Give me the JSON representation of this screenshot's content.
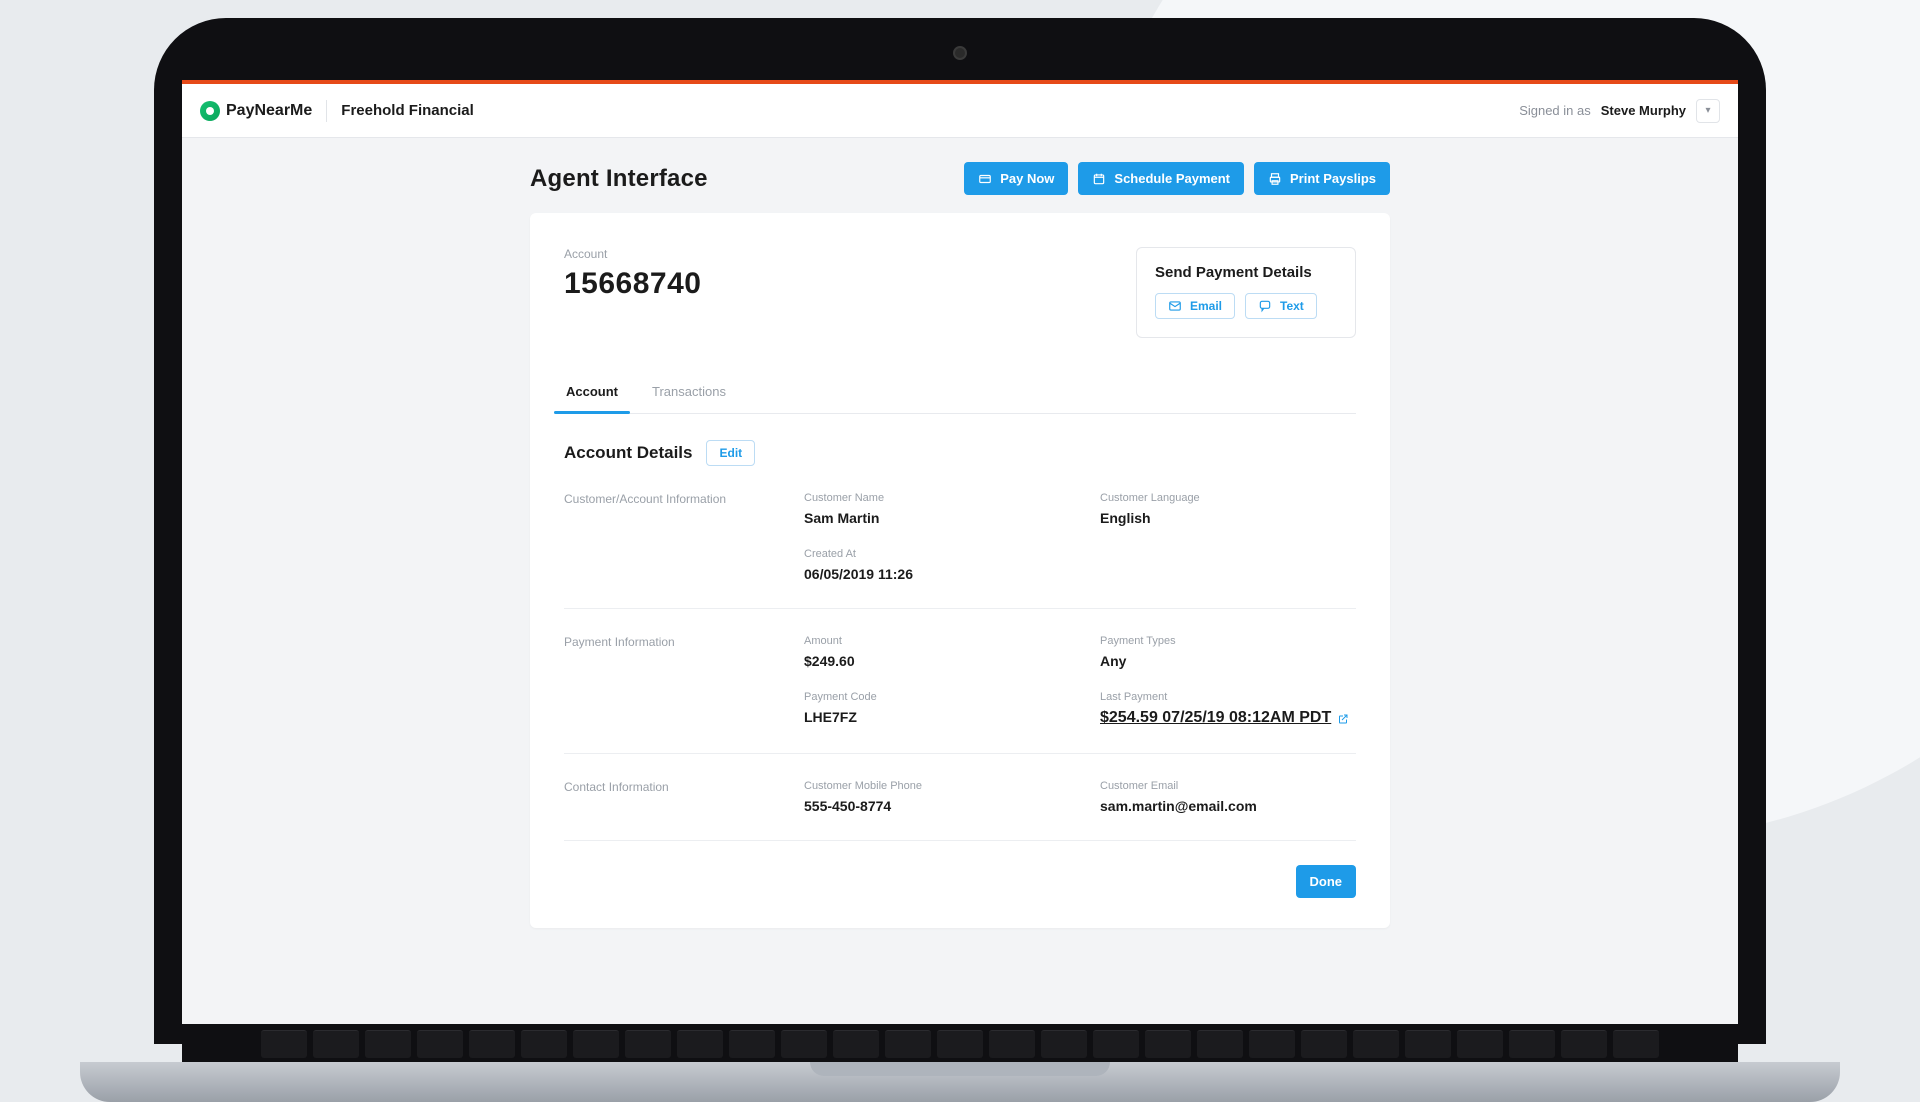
{
  "header": {
    "brand": "PayNearMe",
    "client": "Freehold Financial",
    "signed_in_as_prefix": "Signed in as ",
    "user_name": "Steve Murphy"
  },
  "page": {
    "title": "Agent Interface",
    "actions": {
      "pay_now": "Pay Now",
      "schedule_payment": "Schedule Payment",
      "print_payslips": "Print Payslips"
    }
  },
  "account": {
    "label": "Account",
    "number": "15668740"
  },
  "send_box": {
    "title": "Send Payment Details",
    "email": "Email",
    "text": "Text"
  },
  "tabs": {
    "account": "Account",
    "transactions": "Transactions"
  },
  "details": {
    "title": "Account Details",
    "edit": "Edit",
    "groups": {
      "customer": {
        "label": "Customer/Account Information"
      },
      "payment": {
        "label": "Payment Information"
      },
      "contact": {
        "label": "Contact Information"
      }
    },
    "fields": {
      "customer_name": {
        "label": "Customer Name",
        "value": "Sam Martin"
      },
      "customer_language": {
        "label": "Customer Language",
        "value": "English"
      },
      "created_at": {
        "label": "Created At",
        "value": "06/05/2019 11:26"
      },
      "amount": {
        "label": "Amount",
        "value": "$249.60"
      },
      "payment_types": {
        "label": "Payment Types",
        "value": "Any"
      },
      "payment_code": {
        "label": "Payment Code",
        "value": "LHE7FZ"
      },
      "last_payment": {
        "label": "Last Payment",
        "value": "$254.59 07/25/19 08:12AM PDT"
      },
      "customer_mobile": {
        "label": "Customer Mobile Phone",
        "value": "555-450-8774"
      },
      "customer_email": {
        "label": "Customer Email",
        "value": "sam.martin@email.com"
      }
    }
  },
  "done": "Done"
}
